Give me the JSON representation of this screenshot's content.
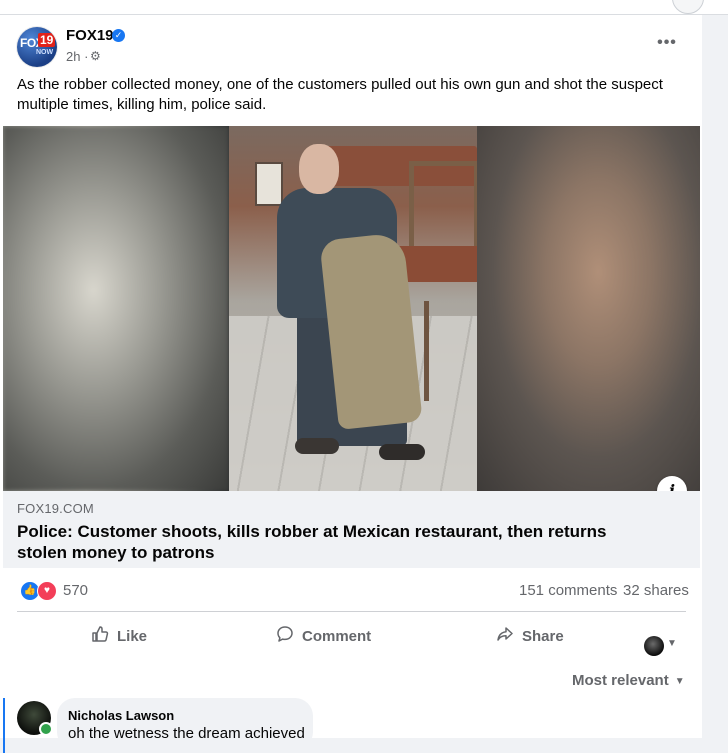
{
  "post": {
    "page_name": "FOX19",
    "time": "2h ·",
    "logo": {
      "fox": "FOX",
      "num": "19",
      "now": "NOW"
    },
    "text": "As the robber collected money, one of the customers pulled out his own gun and shot the suspect multiple times, killing him, police said."
  },
  "link": {
    "domain": "FOX19.COM",
    "title": "Police: Customer shoots, kills robber at Mexican restaurant, then returns stolen money to patrons"
  },
  "stats": {
    "reactions_count": "570",
    "comments": "151 comments",
    "shares": "32 shares"
  },
  "actions": {
    "like": "Like",
    "comment": "Comment",
    "share": "Share"
  },
  "comments_section": {
    "sort_label": "Most relevant",
    "items": [
      {
        "author": "Nicholas Lawson",
        "text": "oh the wetness the dream achieved"
      }
    ]
  },
  "icons": {
    "verified": "verified-badge-icon",
    "gear": "gear-icon",
    "more": "more-options-icon",
    "info": "info-icon",
    "like": "thumbs-up-icon",
    "comment": "speech-bubble-icon",
    "share": "share-arrow-icon"
  },
  "colors": {
    "accent": "#1877f2",
    "love": "#f33e58",
    "online": "#31a24c",
    "muted_text": "#65676b"
  }
}
